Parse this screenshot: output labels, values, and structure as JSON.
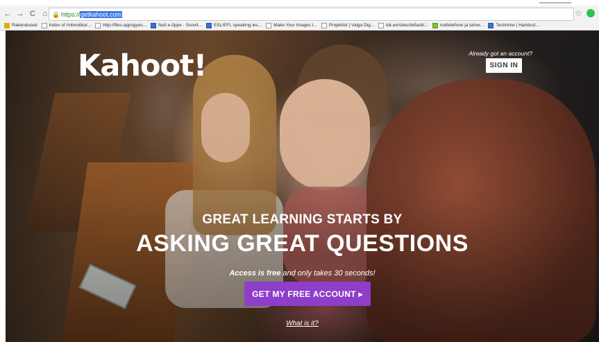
{
  "browser": {
    "url_scheme": "https://",
    "url_host": "getkahoot.com",
    "bookmarks": [
      {
        "label": "Rakendused",
        "icon": "apps-grid-icon"
      },
      {
        "label": "Index of /robootika/...",
        "icon": "page-icon"
      },
      {
        "label": "http://files.appsgyes...",
        "icon": "page-icon"
      },
      {
        "label": "Nuti e-õppe - Soovit...",
        "icon": "bookmark-icon"
      },
      {
        "label": "ESL/EFL speaking les...",
        "icon": "bookmark-icon"
      },
      {
        "label": "Make Your Images I...",
        "icon": "bookmark-icon"
      },
      {
        "label": "Projektist | Valga Dig...",
        "icon": "page-icon"
      },
      {
        "label": "kik.ee/sites/default/...",
        "icon": "page-icon"
      },
      {
        "label": "nutitelefone ja tahve...",
        "icon": "bookmark-icon"
      },
      {
        "label": "Testimine | Haridust...",
        "icon": "bookmark-icon"
      }
    ]
  },
  "header": {
    "logo": "Kahoot!",
    "already_text": "Already got an account?",
    "sign_in_label": "SIGN IN"
  },
  "hero": {
    "line1": "GREAT LEARNING STARTS BY",
    "line2": "ASKING GREAT QUESTIONS",
    "access_bold": "Access is free",
    "access_rest": " and only takes 30 seconds!",
    "cta_label": "GET MY FREE ACCOUNT ▸",
    "what_is": "What is it?"
  },
  "colors": {
    "cta_purple": "#8e3ec9",
    "url_highlight": "#3b78e7"
  }
}
